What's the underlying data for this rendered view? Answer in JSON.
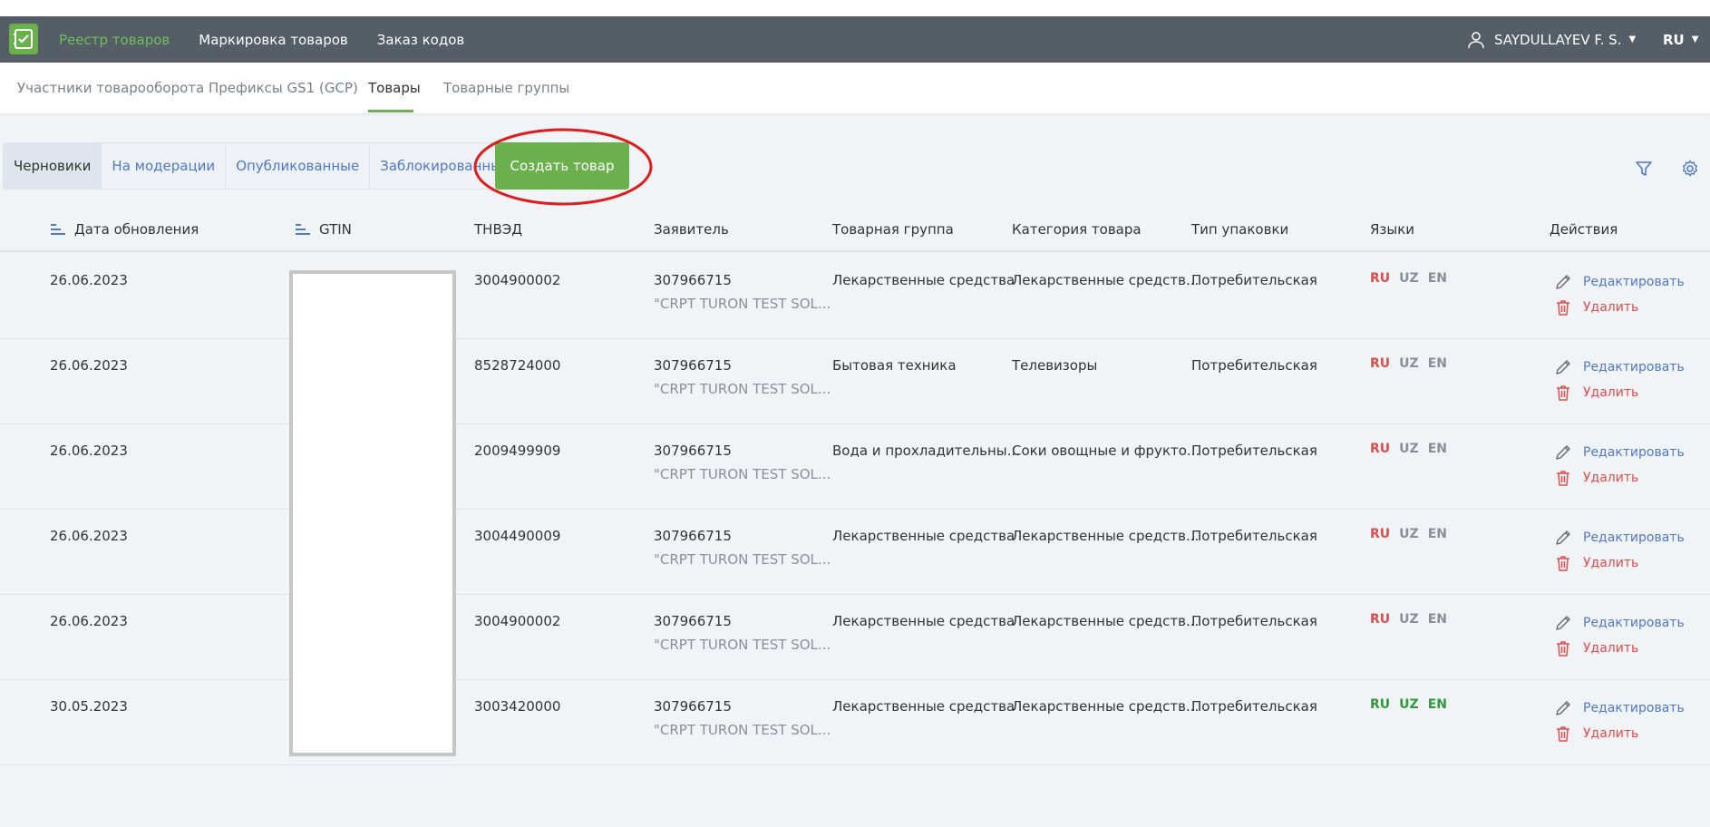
{
  "topbar": {
    "nav": [
      "Реестр товаров",
      "Маркировка товаров",
      "Заказ кодов"
    ],
    "user_name": "SAYDULLAYEV F. S.",
    "lang": "RU"
  },
  "subnav": {
    "tabs": [
      "Участники товарооборота",
      "Префиксы GS1 (GCP)",
      "Товары",
      "Товарные группы"
    ]
  },
  "status_tabs": [
    "Черновики",
    "На модерации",
    "Опубликованные",
    "Заблокированные"
  ],
  "create_button": "Создать товар",
  "table": {
    "headers": {
      "date": "Дата обновления",
      "gtin": "GTIN",
      "tnved": "ТНВЭД",
      "applicant": "Заявитель",
      "group": "Товарная группа",
      "category": "Категория товара",
      "package": "Тип упаковки",
      "languages": "Языки",
      "actions": "Действия"
    },
    "rows": [
      {
        "date": "26.06.2023",
        "tnved": "3004900002",
        "applicant_id": "307966715",
        "applicant_name": "\"CRPT TURON TEST SOL...",
        "group": "Лекарственные средства",
        "category": "Лекарственные средств...",
        "package": "Потребительская",
        "lang_ru": "RU",
        "lang_uz": "UZ",
        "lang_en": "EN"
      },
      {
        "date": "26.06.2023",
        "tnved": "8528724000",
        "applicant_id": "307966715",
        "applicant_name": "\"CRPT TURON TEST SOL...",
        "group": "Бытовая техника",
        "category": "Телевизоры",
        "package": "Потребительская",
        "lang_ru": "RU",
        "lang_uz": "UZ",
        "lang_en": "EN"
      },
      {
        "date": "26.06.2023",
        "tnved": "2009499909",
        "applicant_id": "307966715",
        "applicant_name": "\"CRPT TURON TEST SOL...",
        "group": "Вода и прохладительны...",
        "category": "Соки овощные и фрукто...",
        "package": "Потребительская",
        "lang_ru": "RU",
        "lang_uz": "UZ",
        "lang_en": "EN"
      },
      {
        "date": "26.06.2023",
        "tnved": "3004490009",
        "applicant_id": "307966715",
        "applicant_name": "\"CRPT TURON TEST SOL...",
        "group": "Лекарственные средства",
        "category": "Лекарственные средств...",
        "package": "Потребительская",
        "lang_ru": "RU",
        "lang_uz": "UZ",
        "lang_en": "EN"
      },
      {
        "date": "26.06.2023",
        "tnved": "3004900002",
        "applicant_id": "307966715",
        "applicant_name": "\"CRPT TURON TEST SOL...",
        "group": "Лекарственные средства",
        "category": "Лекарственные средств...",
        "package": "Потребительская",
        "lang_ru": "RU",
        "lang_uz": "UZ",
        "lang_en": "EN"
      },
      {
        "date": "30.05.2023",
        "tnved": "3003420000",
        "applicant_id": "307966715",
        "applicant_name": "\"CRPT TURON TEST SOL...",
        "group": "Лекарственные средства",
        "category": "Лекарственные средств...",
        "package": "Потребительская",
        "lang_ru": "RU",
        "lang_uz": "UZ",
        "lang_en": "EN"
      }
    ],
    "edit_label": "Редактировать",
    "delete_label": "Удалить"
  },
  "colors": {
    "accent_green": "#6ab04c",
    "link_blue": "#4e78c8",
    "danger_red": "#e14b4b",
    "topbar_bg": "#555d66"
  }
}
